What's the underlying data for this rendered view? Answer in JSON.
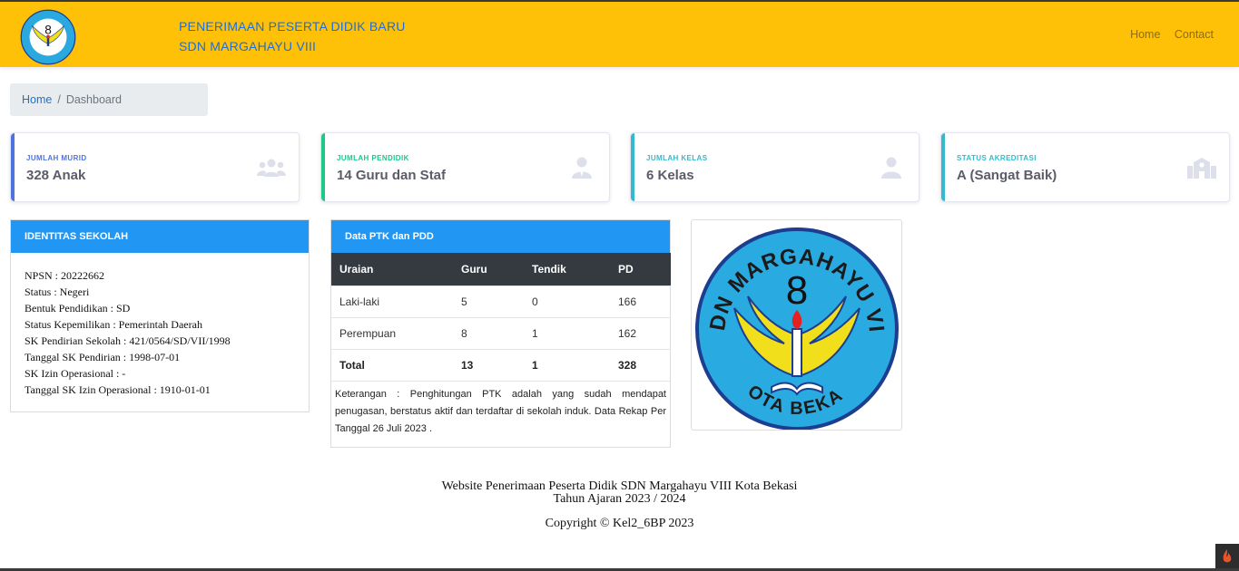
{
  "navbar": {
    "title_line1": "PENERIMAAN PESERTA DIDIK BARU",
    "title_line2": "SDN MARGAHAYU VIII",
    "links": [
      "Home",
      "Contact"
    ]
  },
  "breadcrumb": {
    "home": "Home",
    "separator": "/",
    "current": "Dashboard"
  },
  "cards": [
    {
      "label": "JUMLAH MURID",
      "value": "328 Anak",
      "color": "#4e73df",
      "icon": "users-icon"
    },
    {
      "label": "JUMLAH PENDIDIK",
      "value": "14 Guru dan Staf",
      "color": "#1cc88a",
      "icon": "user-tie-icon"
    },
    {
      "label": "JUMLAH KELAS",
      "value": "6 Kelas",
      "color": "#36b9cc",
      "icon": "user-icon"
    },
    {
      "label": "STATUS AKREDITASI",
      "value": "A (Sangat Baik)",
      "color": "#36b9cc",
      "icon": "school-icon"
    }
  ],
  "identitas": {
    "title": "IDENTITAS SEKOLAH",
    "lines": [
      "NPSN : 20222662",
      "Status : Negeri",
      "Bentuk Pendidikan : SD",
      "Status Kepemilikan : Pemerintah Daerah",
      "SK Pendirian Sekolah : 421/0564/SD/VII/1998",
      "Tanggal SK Pendirian : 1998-07-01",
      "SK Izin Operasional : -",
      "Tanggal SK Izin Operasional : 1910-01-01"
    ]
  },
  "ptk": {
    "title": "Data PTK dan PDD",
    "headers": [
      "Uraian",
      "Guru",
      "Tendik",
      "PD"
    ],
    "rows": [
      [
        "Laki-laki",
        "5",
        "0",
        "166"
      ],
      [
        "Perempuan",
        "8",
        "1",
        "162"
      ],
      [
        "Total",
        "13",
        "1",
        "328"
      ]
    ],
    "note": "Keterangan : Penghitungan PTK adalah yang sudah mendapat penugasan, berstatus aktif dan terdaftar di sekolah induk. Data Rekap Per Tanggal 26 Juli 2023 ."
  },
  "logo": {
    "top_text": "SDN MARGAHAYU VIII",
    "number": "8",
    "bottom_text": "KOTA BEKASI"
  },
  "footer": {
    "line1": "Website Penerimaan Peserta Didik SDN Margahayu VIII Kota Bekasi",
    "line2": "Tahun Ajaran 2023 / 2024",
    "line3": "Copyright © Kel2_6BP 2023"
  },
  "colors": {
    "navbar": "#ffc107",
    "panel_head": "#2196f3",
    "table_head": "#343a40"
  }
}
